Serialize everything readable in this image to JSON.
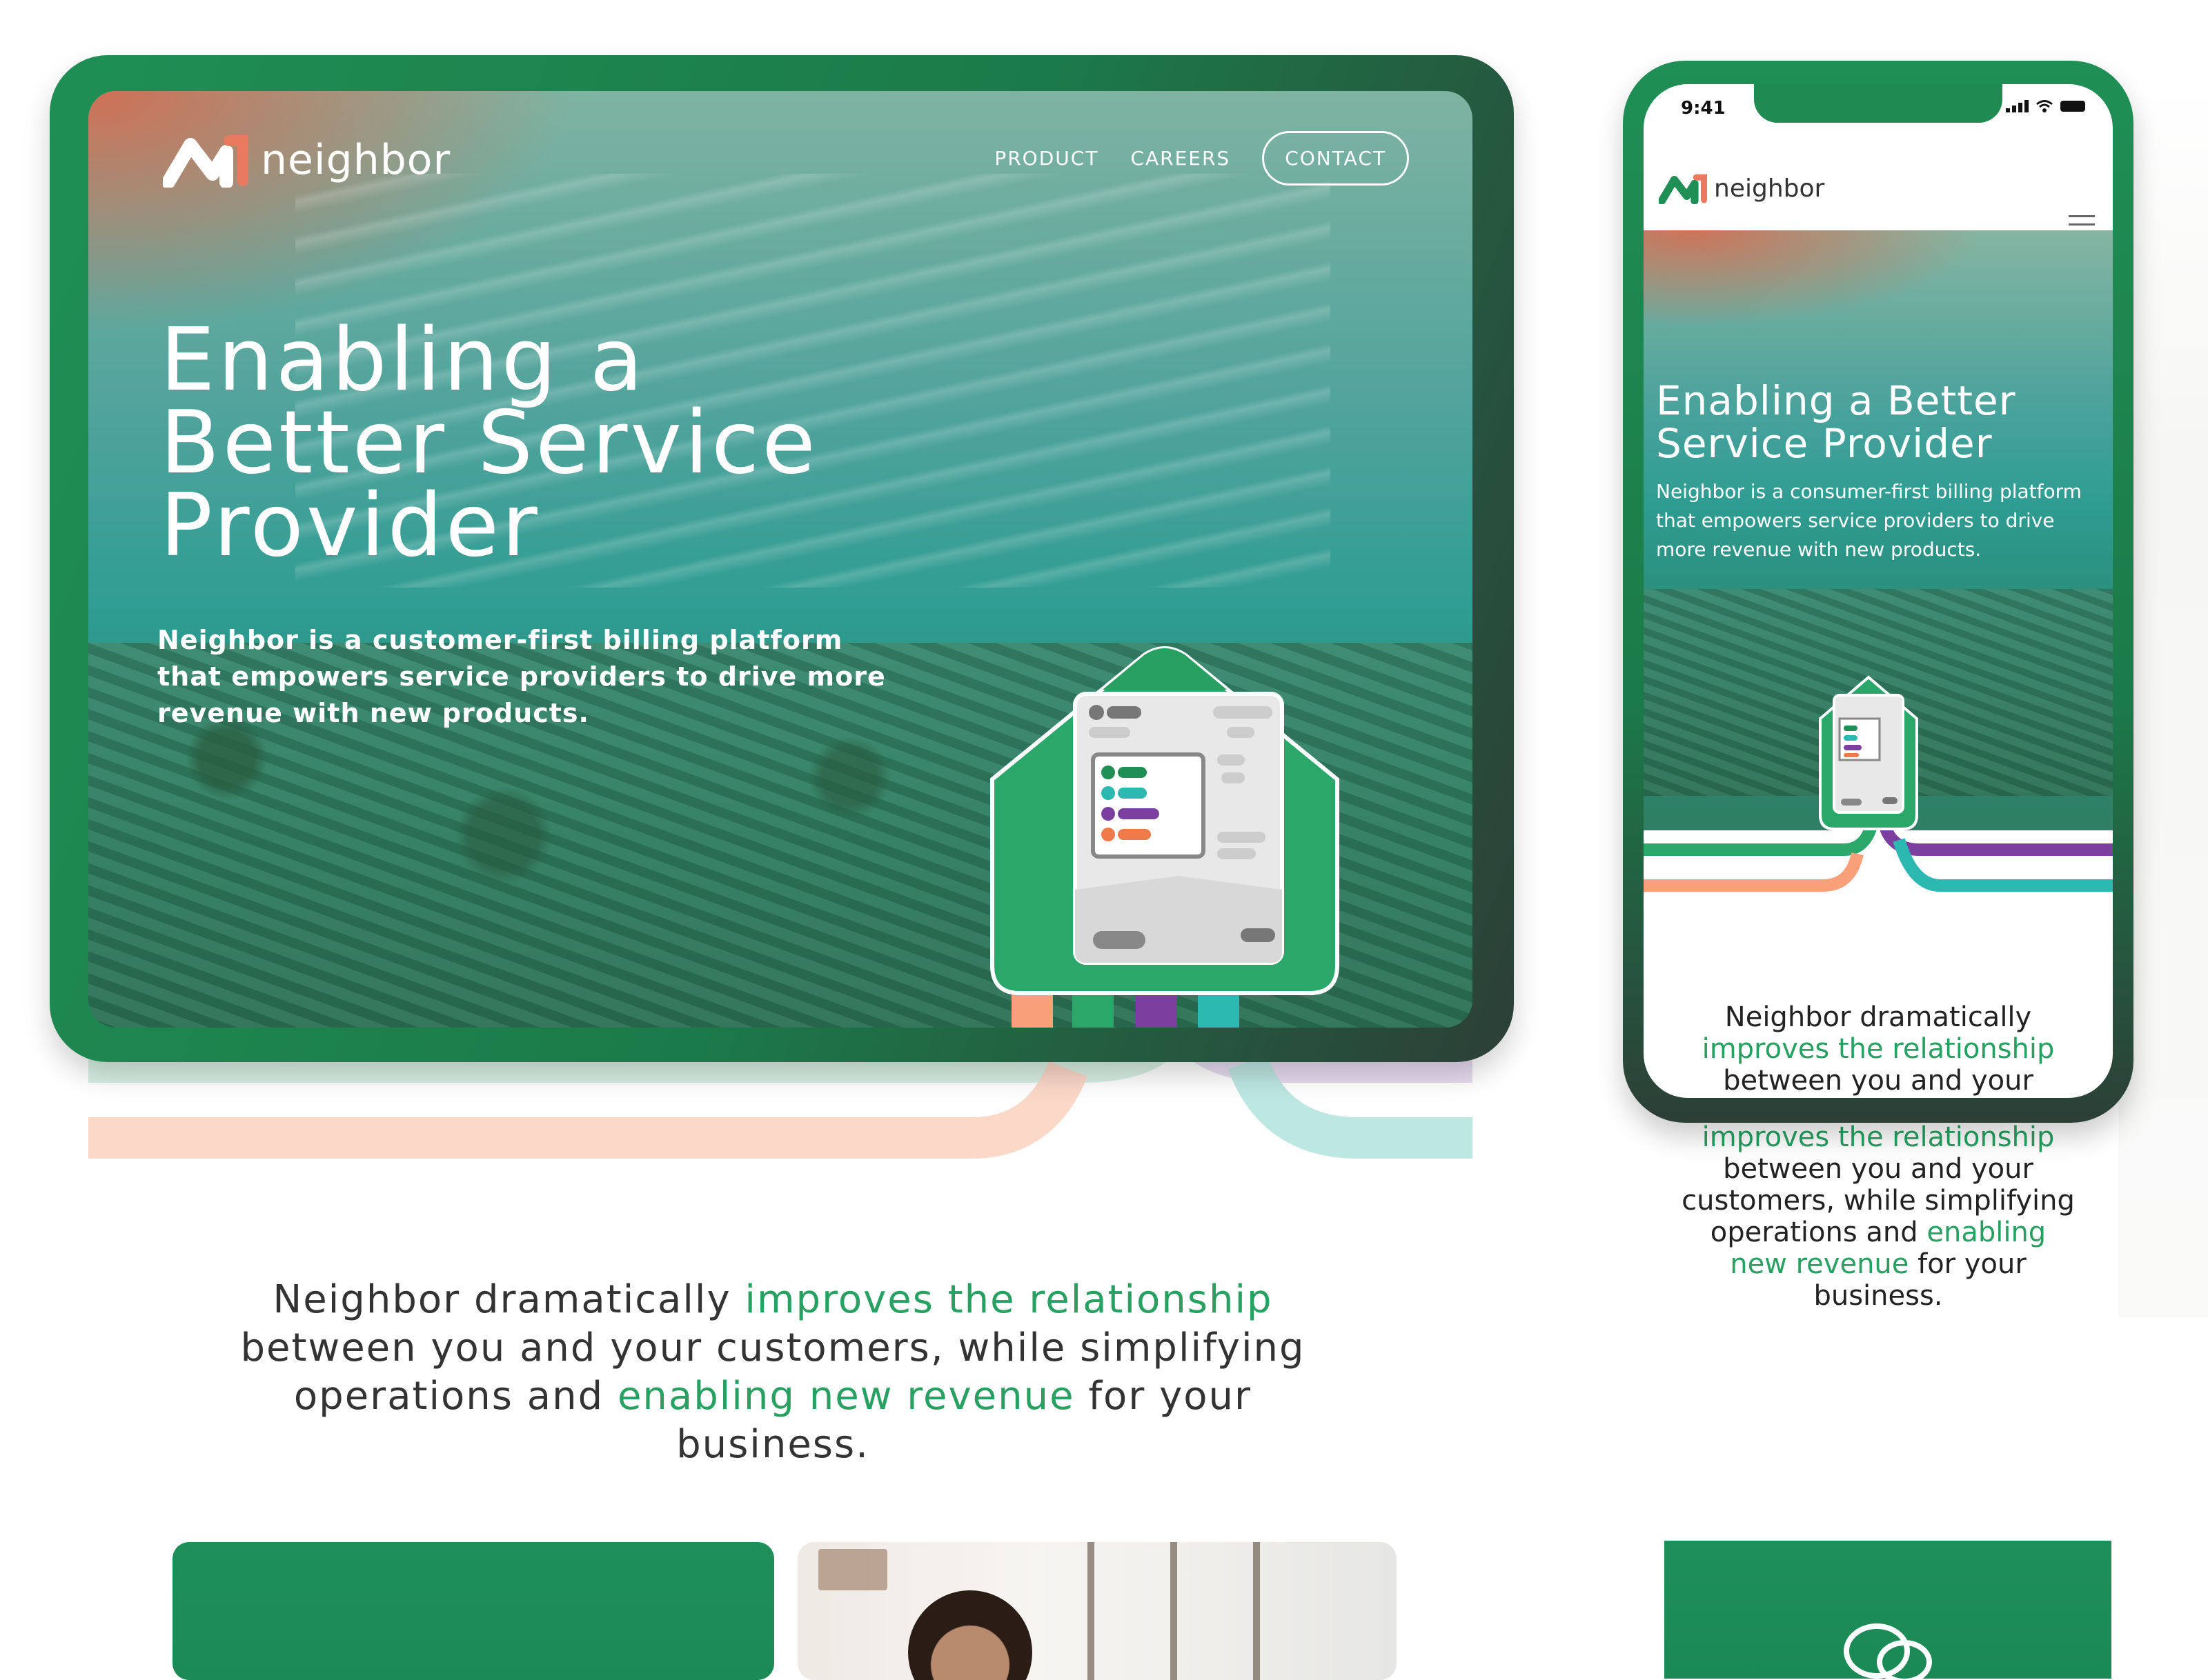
{
  "desktop": {
    "brand": "neighbor",
    "nav": {
      "product": "PRODUCT",
      "careers": "CAREERS",
      "contact": "CONTACT"
    },
    "hero_title": "Enabling a Better Service Provider",
    "hero_subtitle": "Neighbor is a customer-first billing platform that empowers service providers to drive more revenue with new products."
  },
  "mobile": {
    "status_time": "9:41",
    "brand": "neighbor",
    "hero_title": "Enabling a Better Service Provider",
    "hero_subtitle": "Neighbor is a consumer-first billing platform that empowers service providers to drive more revenue with new products.",
    "intro": {
      "part1": "Neighbor dramatically ",
      "hl1": "improves the relationship",
      "part2": " between you and your customers, while simplifying operations and ",
      "hl2": "enabling new revenue",
      "part3": " for your business."
    }
  },
  "tagline": {
    "part1": "Neighbor dramatically ",
    "hl1": "improves the relationship",
    "part2": " between you and your customers, while simplifying operations and ",
    "hl2": "enabling new revenue",
    "part3": " for your business."
  },
  "colors": {
    "brand_green": "#1f8f55",
    "accent_green": "#27a062",
    "ribbon_orange": "#f7a07a",
    "ribbon_green": "#2aa86a",
    "ribbon_purple": "#7b3fa0",
    "ribbon_teal": "#2ab8b0"
  },
  "icons": [
    "logo-mark-icon",
    "menu-icon",
    "chat-icon",
    "signal-icon",
    "wifi-icon",
    "battery-icon"
  ]
}
